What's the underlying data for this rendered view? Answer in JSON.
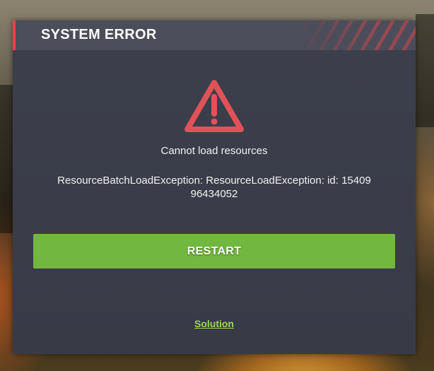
{
  "dialog": {
    "title": "SYSTEM ERROR",
    "icon": "warning-triangle-icon",
    "message": "Cannot load resources",
    "detail": "ResourceBatchLoadException: ResourceLoadException: id: 1540996434052",
    "restart_label": "RESTART",
    "solution_label": "Solution"
  },
  "colors": {
    "accent_red": "#e5444a",
    "button_green": "#72b73f",
    "link_green": "#9ed65a",
    "panel": "#3c3f4c",
    "header": "#4b4d5a"
  }
}
